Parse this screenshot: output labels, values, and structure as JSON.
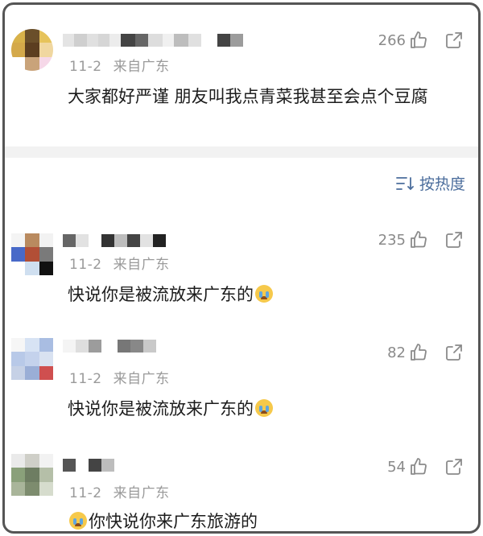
{
  "top_comment": {
    "date": "11-2",
    "location": "来自广东",
    "likes": "266",
    "text": "大家都好严谨 朋友叫我点青菜我甚至会点个豆腐"
  },
  "sort": {
    "label": "按热度",
    "icon": "sort-lines-icon"
  },
  "comments": [
    {
      "date": "11-2",
      "location": "来自广东",
      "likes": "235",
      "text": "快说你是被流放来广东的",
      "emoji_after": "crying-face-emoji"
    },
    {
      "date": "11-2",
      "location": "来自广东",
      "likes": "82",
      "text": "快说你是被流放来广东的",
      "emoji_after": "crying-face-emoji"
    },
    {
      "date": "11-2",
      "location": "来自广东",
      "likes": "54",
      "text": "你快说你来广东旅游的",
      "emoji_before": "crying-face-emoji"
    }
  ],
  "colors": {
    "accent": "#4b6d9c",
    "meta": "#9a9a9a",
    "divider": "#f2f2f2"
  }
}
